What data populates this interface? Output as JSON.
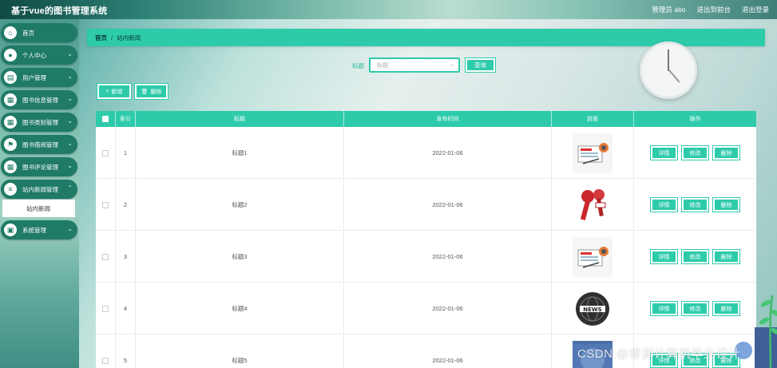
{
  "app": {
    "title": "基于vue的图书管理系统"
  },
  "topbar": {
    "user": "管理员 abo",
    "back_to_front": "退出到前台",
    "logout": "退出登录"
  },
  "sidebar": {
    "items": [
      {
        "label": "首页",
        "icon": "home-icon",
        "expandable": false
      },
      {
        "label": "个人中心",
        "icon": "user-icon",
        "expandable": true
      },
      {
        "label": "用户管理",
        "icon": "clipboard-icon",
        "expandable": true
      },
      {
        "label": "图书信息管理",
        "icon": "grid-icon",
        "expandable": true
      },
      {
        "label": "图书类别管理",
        "icon": "grid-icon",
        "expandable": true
      },
      {
        "label": "图书借阅管理",
        "icon": "flag-icon",
        "expandable": true
      },
      {
        "label": "图书评论管理",
        "icon": "grid-icon",
        "expandable": true
      },
      {
        "label": "站内新闻管理",
        "icon": "list-icon",
        "expandable": true
      },
      {
        "label": "系统管理",
        "icon": "box-icon",
        "expandable": true
      }
    ],
    "submenu": {
      "label": "站内新闻"
    }
  },
  "breadcrumb": {
    "home": "首页",
    "separator": "/",
    "current": "站内新闻"
  },
  "search": {
    "label": "标题",
    "placeholder": "标题",
    "button": "查询"
  },
  "actions": {
    "add": "新增",
    "delete": "删除"
  },
  "table": {
    "headers": [
      "",
      "索引",
      "标题",
      "发布时间",
      "封面",
      "操作"
    ],
    "rows": [
      {
        "index": "1",
        "title": "标题1",
        "date": "2022-01-06",
        "cover": "news-paper"
      },
      {
        "index": "2",
        "title": "标题2",
        "date": "2022-01-06",
        "cover": "microphones"
      },
      {
        "index": "3",
        "title": "标题3",
        "date": "2022-01-06",
        "cover": "news-paper"
      },
      {
        "index": "4",
        "title": "标题4",
        "date": "2022-01-06",
        "cover": "news-globe"
      },
      {
        "index": "5",
        "title": "标题5",
        "date": "2022-01-06",
        "cover": "world-news"
      }
    ],
    "row_actions": {
      "detail": "详情",
      "edit": "修改",
      "delete": "删除"
    }
  },
  "watermark": "CSDN @睿渊计算机毕业设计",
  "colors": {
    "accent": "#2ecbab",
    "menu": "#1f7a66"
  }
}
